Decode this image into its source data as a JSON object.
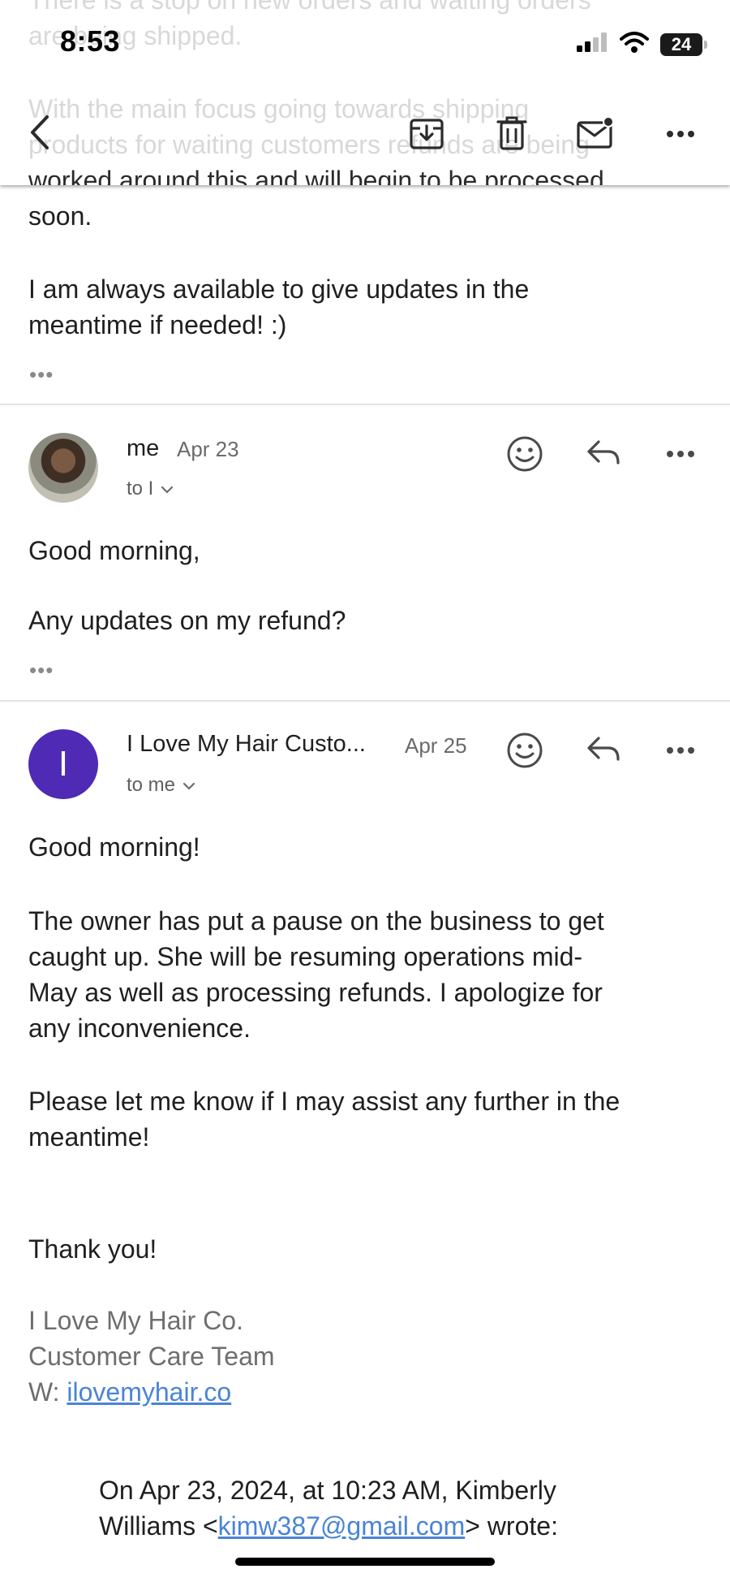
{
  "status_bar": {
    "time": "8:53",
    "battery": "24",
    "signal_icon": "cellular-signal-icon",
    "wifi_icon": "wifi-icon"
  },
  "toolbar": {
    "back_icon": "chevron-left-icon",
    "archive_icon": "archive-icon",
    "delete_icon": "trash-icon",
    "mark_unread_icon": "mail-unread-icon",
    "more_icon": "more-horizontal-icon"
  },
  "behind_toolbar_text": {
    "line1": "There is a stop on new orders and waiting orders",
    "line2": "are being shipped.",
    "line3": "With the main focus going towards shipping",
    "line4": "products for waiting customers refunds are being",
    "line5": "worked around this and will begin to be processed"
  },
  "previous_message": {
    "tail_line": "soon.",
    "para2_line1": "I am always available to give updates in the",
    "para2_line2": "meantime if needed! :)",
    "trimmed": "•••"
  },
  "message_me": {
    "sender": "me",
    "date": "Apr 23",
    "recipient": "to I",
    "greeting": "Good morning,",
    "body": "Any updates on my refund?",
    "trimmed": "•••"
  },
  "message_reply": {
    "avatar_letter": "I",
    "sender": "I Love My Hair Custo...",
    "date": "Apr 25",
    "recipient": "to me",
    "greeting": "Good morning!",
    "para1_line1": "The owner has put a pause on the business to get",
    "para1_line2": "caught up. She will be resuming operations mid-",
    "para1_line3": "May as well as processing refunds. I apologize for",
    "para1_line4": "any inconvenience.",
    "para2_line1": "Please let me know if I may assist any further in the",
    "para2_line2": "meantime!",
    "closing": "Thank you!",
    "signature": {
      "company": "I Love My Hair Co.",
      "team": "Customer Care Team",
      "web_prefix": "W: ",
      "web_link": "ilovemyhair.co"
    },
    "quote": {
      "line1": "On Apr 23, 2024, at 10:23 AM, Kimberly",
      "line2_prefix": "Williams <",
      "email": "kimw387@gmail.com",
      "line2_suffix": "> wrote:"
    }
  },
  "colors": {
    "avatar_purple": "#4f2ab5",
    "link_blue": "#4a84d6",
    "signature_gray": "#6e6e6e"
  }
}
